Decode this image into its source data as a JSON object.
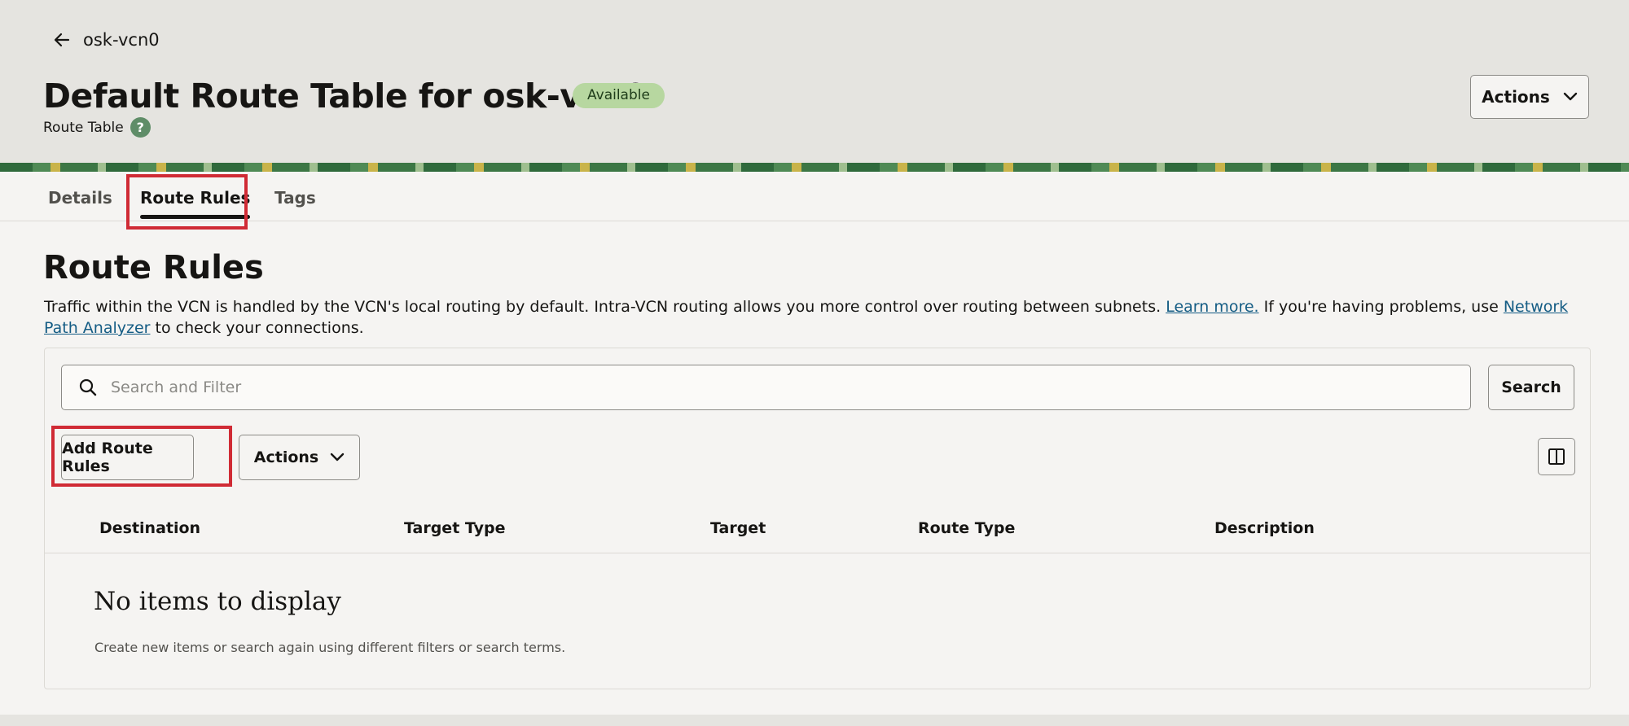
{
  "header": {
    "back_label": "osk-vcn0",
    "title": "Default Route Table for osk-vcn0",
    "status": "Available",
    "subtitle": "Route Table",
    "help_glyph": "?",
    "actions_label": "Actions"
  },
  "tabs": [
    {
      "label": "Details"
    },
    {
      "label": "Route Rules"
    },
    {
      "label": "Tags"
    }
  ],
  "section": {
    "title": "Route Rules",
    "description_prefix": "Traffic within the VCN is handled by the VCN's local routing by default. Intra-VCN routing allows you more control over routing between subnets. ",
    "learn_more": "Learn more.",
    "description_middle": " If you're having problems, use ",
    "network_path_link": "Network Path Analyzer",
    "description_suffix": " to check your connections."
  },
  "search": {
    "placeholder": "Search and Filter",
    "value": "",
    "button_label": "Search"
  },
  "toolbar": {
    "add_label": "Add Route Rules",
    "actions_label": "Actions"
  },
  "table": {
    "columns": [
      "Destination",
      "Target Type",
      "Target",
      "Route Type",
      "Description"
    ],
    "rows": [],
    "empty_title": "No items to display",
    "empty_text": "Create new items or search again using different filters or search terms."
  },
  "icons": {
    "back": "arrow-left-icon",
    "help": "help-icon",
    "search": "search-icon",
    "chevron": "chevron-down-icon",
    "columns": "columns-icon"
  },
  "colors": {
    "status_badge": "#b7d7a0",
    "highlight": "#d02b35",
    "link": "#145c84",
    "help_icon": "#5f8d68"
  }
}
